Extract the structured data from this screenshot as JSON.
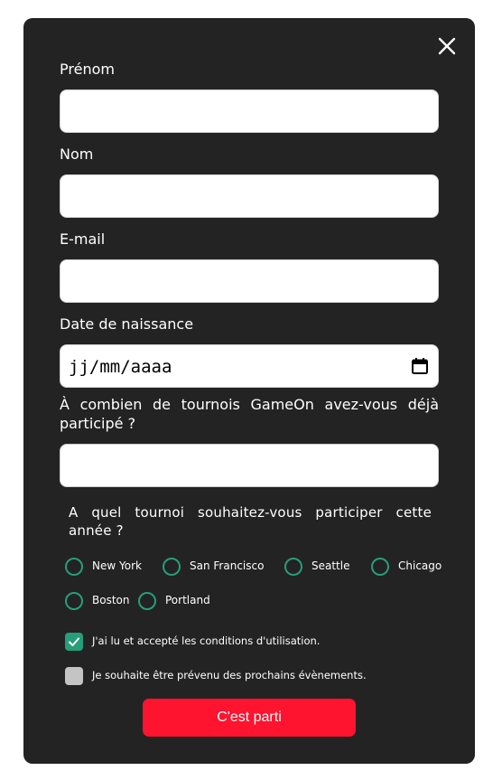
{
  "colors": {
    "modal_bg": "#232323",
    "accent": "#279e7a",
    "submit_bg": "#fe142f",
    "checkbox_unchecked": "#c4c4c4"
  },
  "header": {
    "close_icon": "close-icon"
  },
  "form": {
    "first_name": {
      "label": "Prénom",
      "value": ""
    },
    "last_name": {
      "label": "Nom",
      "value": ""
    },
    "email": {
      "label": "E-mail",
      "value": ""
    },
    "birthdate": {
      "label": "Date de naissance",
      "placeholder": "jj/mm/aaaa",
      "icon": "calendar-icon"
    },
    "tournaments_count": {
      "label": "À combien de tournois GameOn avez-vous déjà participé ?",
      "value": ""
    },
    "location": {
      "label": "A quel tournoi souhaitez-vous participer cette année ?",
      "options": [
        "New York",
        "San Francisco",
        "Seattle",
        "Chicago",
        "Boston",
        "Portland"
      ],
      "selected": null
    },
    "terms": {
      "label": "J'ai lu et accepté les conditions d'utilisation.",
      "checked": true
    },
    "newsletter": {
      "label": "Je souhaite être prévenu des prochains évènements.",
      "checked": false
    },
    "submit_label": "C'est parti"
  }
}
